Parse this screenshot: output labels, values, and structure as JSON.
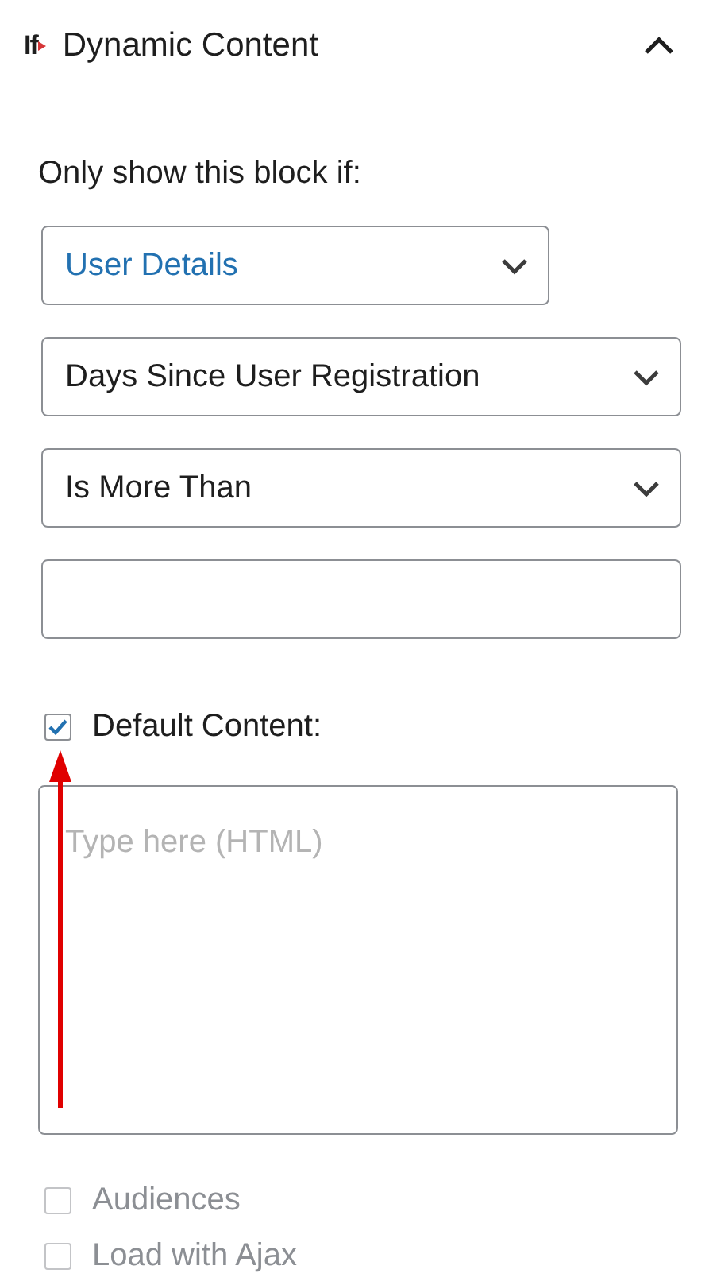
{
  "panel": {
    "logo_text": "If",
    "title": "Dynamic Content",
    "expanded": true
  },
  "condition_label": "Only show this block if:",
  "fields": [
    {
      "kind": "select",
      "value": "User Details",
      "highlighted": true
    },
    {
      "kind": "select",
      "value": "Days Since User Registration",
      "highlighted": false
    },
    {
      "kind": "select",
      "value": "Is More Than",
      "highlighted": false
    },
    {
      "kind": "text"
    }
  ],
  "default_content": {
    "label": "Default Content:",
    "checked": true,
    "placeholder": "Type here (HTML)"
  },
  "options": [
    {
      "label": "Audiences",
      "checked": false,
      "disabled": true
    },
    {
      "label": "Load with Ajax",
      "checked": false,
      "disabled": true
    }
  ],
  "annotation": {
    "kind": "arrow"
  }
}
